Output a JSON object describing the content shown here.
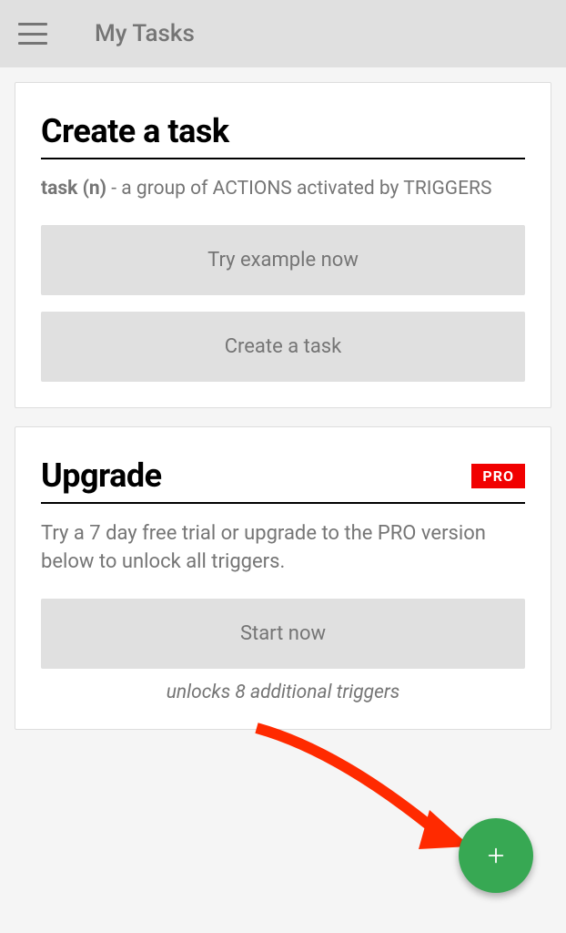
{
  "header": {
    "title": "My Tasks"
  },
  "cards": {
    "create": {
      "title": "Create a task",
      "def_term": "task (n)",
      "def_sep": " -",
      "def_body": "a group of ACTIONS activated by TRIGGERS",
      "btn_example": "Try example now",
      "btn_create": "Create a task"
    },
    "upgrade": {
      "title": "Upgrade",
      "badge": "PRO",
      "desc": "Try a 7 day free trial or upgrade to the PRO version below to unlock all triggers.",
      "btn_start": "Start now",
      "subtext": "unlocks 8 additional triggers"
    }
  },
  "colors": {
    "fab": "#37a853",
    "badge": "#f10000"
  }
}
